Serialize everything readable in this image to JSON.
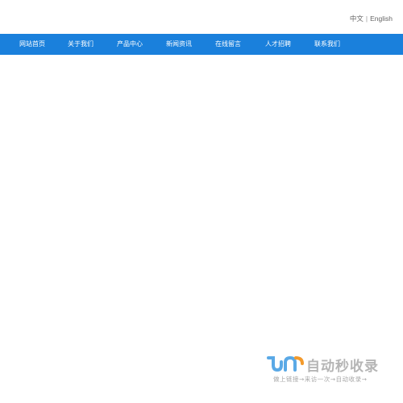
{
  "header": {
    "lang_zh": "中文",
    "lang_sep": "|",
    "lang_en": "English"
  },
  "nav": {
    "items": [
      {
        "label": "网站首页"
      },
      {
        "label": "关于我们"
      },
      {
        "label": "产品中心"
      },
      {
        "label": "新闻资讯"
      },
      {
        "label": "在线留言"
      },
      {
        "label": "人才招聘"
      },
      {
        "label": "联系我们"
      }
    ]
  },
  "colors": {
    "nav_background": "#1a80dc",
    "nav_text": "#ffffff",
    "watermark_blue": "#5aa9e6",
    "watermark_orange": "#f39a2b"
  },
  "watermark": {
    "title": "自动秒收录",
    "subtitle": "做上链接→来访一次→自动收录→"
  }
}
